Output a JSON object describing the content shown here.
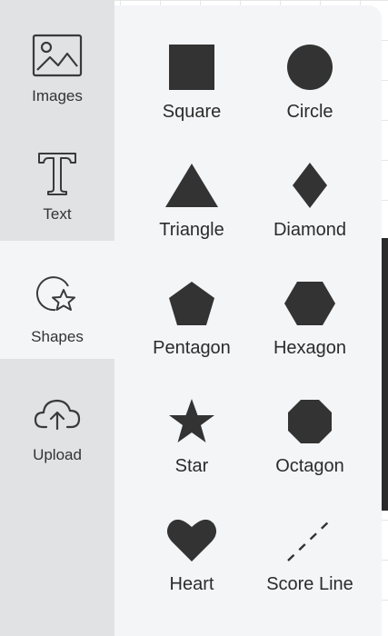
{
  "rail": {
    "items": [
      {
        "label": "Images",
        "icon": "image-icon"
      },
      {
        "label": "Text",
        "icon": "text-icon"
      },
      {
        "label": "Shapes",
        "icon": "shapes-icon",
        "active": true
      },
      {
        "label": "Upload",
        "icon": "cloud-upload-icon"
      }
    ]
  },
  "shapes": {
    "items": [
      {
        "label": "Square",
        "icon": "square-icon"
      },
      {
        "label": "Circle",
        "icon": "circle-icon"
      },
      {
        "label": "Triangle",
        "icon": "triangle-icon"
      },
      {
        "label": "Diamond",
        "icon": "diamond-icon"
      },
      {
        "label": "Pentagon",
        "icon": "pentagon-icon"
      },
      {
        "label": "Hexagon",
        "icon": "hexagon-icon"
      },
      {
        "label": "Star",
        "icon": "star-icon"
      },
      {
        "label": "Octagon",
        "icon": "octagon-icon"
      },
      {
        "label": "Heart",
        "icon": "heart-icon"
      },
      {
        "label": "Score Line",
        "icon": "score-line-icon"
      }
    ]
  },
  "colors": {
    "rail_bg": "#e1e2e4",
    "panel_bg": "#f4f5f7",
    "shape_fill": "#333333"
  }
}
